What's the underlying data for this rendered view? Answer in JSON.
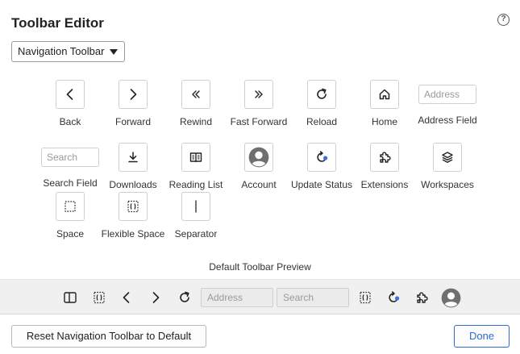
{
  "window": {
    "title": "Toolbar Editor",
    "help_label": "?"
  },
  "toolbar_select": {
    "value": "Navigation Toolbar"
  },
  "items": [
    {
      "label": "Back",
      "icon": "chevron-left-icon"
    },
    {
      "label": "Forward",
      "icon": "chevron-right-icon"
    },
    {
      "label": "Rewind",
      "icon": "double-chevron-left-icon"
    },
    {
      "label": "Fast Forward",
      "icon": "double-chevron-right-icon"
    },
    {
      "label": "Reload",
      "icon": "reload-icon"
    },
    {
      "label": "Home",
      "icon": "home-icon"
    },
    {
      "label": "Address Field",
      "placeholder": "Address"
    },
    {
      "label": "Search Field",
      "placeholder": "Search"
    },
    {
      "label": "Downloads",
      "icon": "download-icon"
    },
    {
      "label": "Reading List",
      "icon": "book-icon"
    },
    {
      "label": "Account",
      "icon": "avatar-icon"
    },
    {
      "label": "Update Status",
      "icon": "update-status-icon"
    },
    {
      "label": "Extensions",
      "icon": "puzzle-icon"
    },
    {
      "label": "Workspaces",
      "icon": "layers-icon"
    },
    {
      "label": "Space",
      "icon": "space-icon"
    },
    {
      "label": "Flexible Space",
      "icon": "flexible-space-icon"
    },
    {
      "label": "Separator",
      "icon": "separator-icon"
    }
  ],
  "preview": {
    "label": "Default Toolbar Preview",
    "address_placeholder": "Address",
    "search_placeholder": "Search"
  },
  "footer": {
    "reset_label": "Reset Navigation Toolbar to Default",
    "done_label": "Done"
  },
  "colors": {
    "accent": "#2f6ad0",
    "update_dot": "#3d6fe0"
  }
}
